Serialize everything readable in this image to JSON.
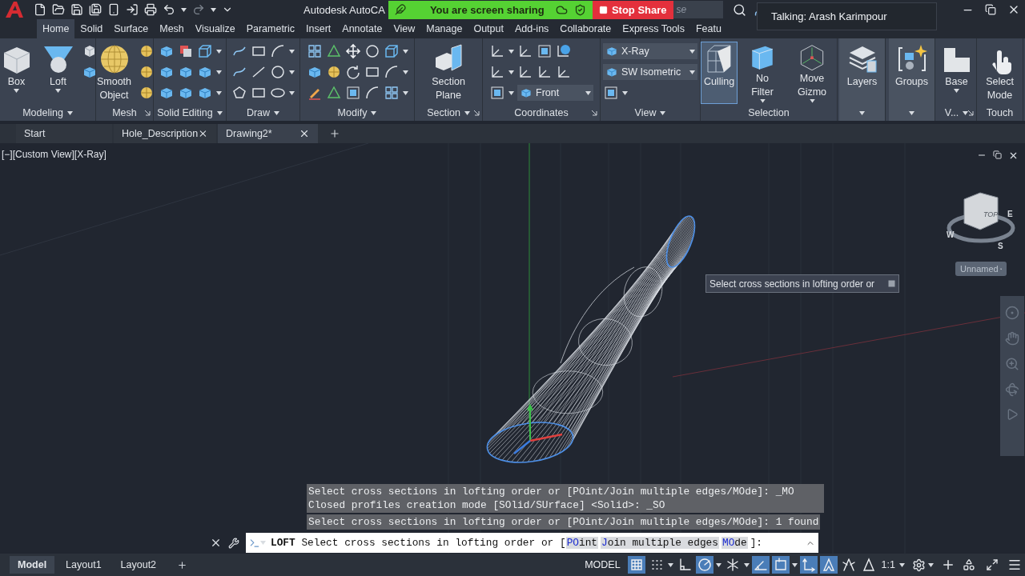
{
  "app": {
    "title": "Autodesk AutoCA"
  },
  "screen_share": {
    "status": "You are screen sharing",
    "stop_label": "Stop Share"
  },
  "search": {
    "placeholder": "se"
  },
  "talking": {
    "text": "Talking: Arash Karimpour"
  },
  "ribbon_tabs": [
    {
      "label": "Home",
      "selected": true
    },
    {
      "label": "Solid",
      "selected": false
    },
    {
      "label": "Surface",
      "selected": false
    },
    {
      "label": "Mesh",
      "selected": false
    },
    {
      "label": "Visualize",
      "selected": false
    },
    {
      "label": "Parametric",
      "selected": false
    },
    {
      "label": "Insert",
      "selected": false
    },
    {
      "label": "Annotate",
      "selected": false
    },
    {
      "label": "View",
      "selected": false
    },
    {
      "label": "Manage",
      "selected": false
    },
    {
      "label": "Output",
      "selected": false
    },
    {
      "label": "Add-ins",
      "selected": false
    },
    {
      "label": "Collaborate",
      "selected": false
    },
    {
      "label": "Express Tools",
      "selected": false
    },
    {
      "label": "Featu",
      "selected": false
    }
  ],
  "panels": [
    {
      "kind": "modeling",
      "title": "Modeling",
      "menu": true,
      "launcher": false,
      "large": [
        {
          "kind": "box",
          "label": "Box",
          "menu": true,
          "selected": false
        },
        {
          "kind": "loft",
          "label": "Loft",
          "menu": true,
          "selected": false
        }
      ]
    },
    {
      "kind": "mesh",
      "title": "Mesh",
      "menu": false,
      "launcher": true,
      "large": [
        {
          "kind": "sphere",
          "label": "Smooth Object",
          "menu": false,
          "selected": false
        }
      ]
    },
    {
      "kind": "solid_editing",
      "title": "Solid Editing",
      "menu": true,
      "launcher": false
    },
    {
      "kind": "draw",
      "title": "Draw",
      "menu": true,
      "launcher": false
    },
    {
      "kind": "modify",
      "title": "Modify",
      "menu": true,
      "launcher": false
    },
    {
      "kind": "section",
      "title": "Section",
      "menu": true,
      "launcher": true,
      "large": [
        {
          "kind": "plane",
          "label": "Section Plane",
          "menu": false,
          "selected": false
        }
      ]
    },
    {
      "kind": "coordinates",
      "title": "Coordinates",
      "menu": false,
      "launcher": true,
      "dropdowns": [
        {
          "label": "Front"
        }
      ]
    },
    {
      "kind": "view",
      "title": "View",
      "menu": true,
      "launcher": false,
      "dropdowns": [
        {
          "label": "X-Ray"
        },
        {
          "label": "SW Isometric"
        }
      ]
    },
    {
      "kind": "selection",
      "title": "Selection",
      "menu": false,
      "launcher": false,
      "large": [
        {
          "kind": "culling",
          "label": "Culling",
          "menu": false,
          "selected": true
        },
        {
          "kind": "filter",
          "label": "No Filter",
          "menu": true,
          "selected": false
        },
        {
          "kind": "gizmo",
          "label": "Move Gizmo",
          "menu": true,
          "selected": false
        }
      ]
    },
    {
      "kind": "layers",
      "menu": true,
      "launcher": false,
      "large": [
        {
          "kind": "layers",
          "label": "Layers",
          "menu": false,
          "selected": false
        }
      ]
    },
    {
      "kind": "groups",
      "menu": true,
      "launcher": false,
      "large": [
        {
          "kind": "groups",
          "label": "Groups",
          "menu": false,
          "selected": false
        }
      ]
    },
    {
      "kind": "view_base",
      "title": "V...",
      "menu": true,
      "launcher": true,
      "large": [
        {
          "kind": "base",
          "label": "Base",
          "menu": true,
          "selected": false
        }
      ]
    },
    {
      "kind": "touch",
      "title": "Touch",
      "menu": false,
      "launcher": false,
      "large": [
        {
          "kind": "touch",
          "label": "Select Mode",
          "menu": false,
          "selected": false
        }
      ]
    }
  ],
  "doc_tabs": [
    {
      "label": "Start",
      "selected": false,
      "closable": false
    },
    {
      "label": "Hole_Description",
      "selected": false,
      "closable": true
    },
    {
      "label": "Drawing2*",
      "selected": true,
      "closable": true
    }
  ],
  "viewport": {
    "label": "[−][Custom View][X-Ray]",
    "viewcube": {
      "face": "TOP",
      "directions": [
        "W",
        "E",
        "S"
      ]
    },
    "view_name": "Unnamed",
    "tooltip": "Select cross sections in lofting order or"
  },
  "command": {
    "history": [
      "Select cross sections in lofting order or [POint/Join multiple edges/MOde]: _MO Closed profiles creation mode [SOlid/SUrface] <Solid>: _SO",
      "Select cross sections in lofting order or [POint/Join multiple edges/MOde]: 1 found"
    ],
    "name": "LOFT",
    "prompt": "Select cross sections in lofting order or [",
    "options": [
      {
        "key": "PO",
        "rest": "int"
      },
      {
        "key": "J",
        "rest": "oin multiple edges"
      },
      {
        "key": "MO",
        "rest": "de"
      }
    ],
    "suffix": "]:"
  },
  "layout_tabs": [
    {
      "label": "Model",
      "selected": true
    },
    {
      "label": "Layout1",
      "selected": false
    },
    {
      "label": "Layout2",
      "selected": false
    }
  ],
  "status": {
    "space": "MODEL",
    "scale": "1:1",
    "toggles": [
      {
        "kind": "grid",
        "on": true,
        "menu": false
      },
      {
        "kind": "snap",
        "on": false,
        "menu": true
      },
      {
        "kind": "ortho",
        "on": false,
        "menu": false
      },
      {
        "kind": "polar",
        "on": true,
        "menu": true
      },
      {
        "kind": "isodraft",
        "on": false,
        "menu": true
      },
      {
        "kind": "otrack",
        "on": true,
        "menu": false
      },
      {
        "kind": "osnap",
        "on": true,
        "menu": true
      },
      {
        "kind": "dynucs",
        "on": true,
        "menu": false
      },
      {
        "kind": "annovis",
        "on": true,
        "menu": false
      },
      {
        "kind": "autoscale",
        "on": false,
        "menu": false
      },
      {
        "kind": "annoscale",
        "on": false,
        "menu": false
      }
    ]
  }
}
